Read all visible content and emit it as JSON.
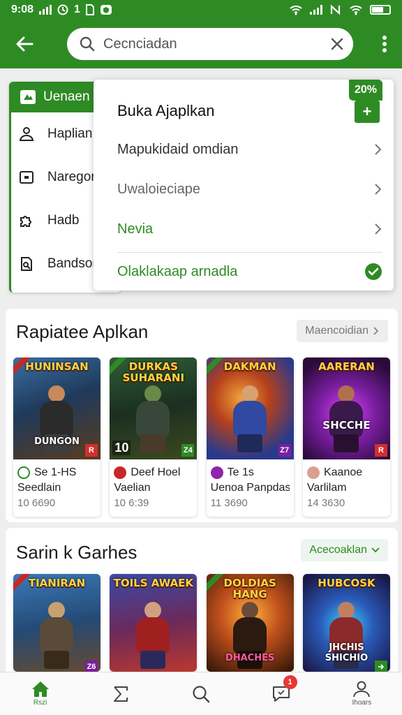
{
  "status_bar": {
    "time": "9:08",
    "left_glyphs": "1",
    "icons": [
      "signal-icon",
      "clock-icon",
      "sim-icon",
      "shield-icon",
      "wifi-icon",
      "signal-icon",
      "nfc-icon",
      "wifi-icon",
      "battery-icon"
    ]
  },
  "search": {
    "placeholder": "Cecnciadan",
    "value": ""
  },
  "side_menu": {
    "header": "Uenaen",
    "items": [
      {
        "label": "Haplian",
        "icon": "person-icon"
      },
      {
        "label": "Naregon",
        "icon": "box-icon"
      },
      {
        "label": "Hadb",
        "icon": "puzzle-icon"
      },
      {
        "label": "Bandson",
        "icon": "search-doc-icon"
      }
    ]
  },
  "dropdown": {
    "title": "Buka Ajaplkan",
    "badge": "20%",
    "plus": "+",
    "items": [
      {
        "label": "Mapukidaid omdian",
        "color": "#333333"
      },
      {
        "label": "Uwaloieciape",
        "color": "#666666"
      },
      {
        "label": "Nevia",
        "color": "#2e8b24"
      }
    ],
    "selected": "Olaklakaap arnadla",
    "accent": "#2e8b24"
  },
  "sections": [
    {
      "title": "Rapiatee Aplkan",
      "action": "Maencoidian",
      "cards": [
        {
          "cover_title": "HUNINSAN",
          "cover_sub": "DUNGON",
          "tag": "R",
          "tag_color": "#d32f2f",
          "l1": "Se 1-HS",
          "l2": "Seedlain",
          "meta": "10 6690",
          "icon_color": "#2e8b24"
        },
        {
          "cover_title": "DURKAS SUHARANI",
          "cover_sub": "",
          "rating": "10",
          "tag": "Z4",
          "tag_color": "#2e8b24",
          "l1": "Deef Hoel",
          "l2": "Vaelian",
          "meta": "10 6:39",
          "icon_color": "#c62828"
        },
        {
          "cover_title": "DAKMAN",
          "cover_sub": "",
          "tag": "Z7",
          "tag_color": "#7b1fa2",
          "l1": "Te 1s",
          "l2": "Uenoa Panpdas",
          "meta": "11 3690",
          "icon_color": "#8e24aa"
        },
        {
          "cover_title": "AARERAN",
          "cover_sub": "SHCCHE",
          "tag": "R",
          "tag_color": "#d32f2f",
          "l1": "Kaanoe",
          "l2": "Varlilam",
          "meta": "14 3630",
          "icon_color": "#d9a090"
        }
      ]
    },
    {
      "title": "Sarin k Garhes",
      "action": "Acecoaklan",
      "cards": [
        {
          "cover_title": "TIANIRAN",
          "cover_sub": "",
          "tag": "Z6",
          "tag_color": "#7b1fa2"
        },
        {
          "cover_title": "TOILS AWAEK",
          "cover_sub": "",
          "tag": "",
          "tag_color": ""
        },
        {
          "cover_title": "DOLDIAS HANG",
          "cover_sub": "DHACHES",
          "tag": "",
          "tag_color": ""
        },
        {
          "cover_title": "HUBCOSK",
          "cover_sub": "JHCHIS SHICHIO",
          "tag": "",
          "tag_color": "#2e8b24"
        }
      ]
    }
  ],
  "bottom_nav": [
    {
      "label": "Rszi",
      "icon": "home-icon",
      "active": true
    },
    {
      "label": "",
      "icon": "sigma-icon",
      "active": false
    },
    {
      "label": "",
      "icon": "search-icon",
      "active": false
    },
    {
      "label": "",
      "icon": "chat-icon",
      "active": false,
      "badge": "1"
    },
    {
      "label": "Ihoars",
      "icon": "profile-icon",
      "active": false
    }
  ],
  "colors": {
    "brand": "#2e8b24",
    "badge": "#e53935"
  }
}
